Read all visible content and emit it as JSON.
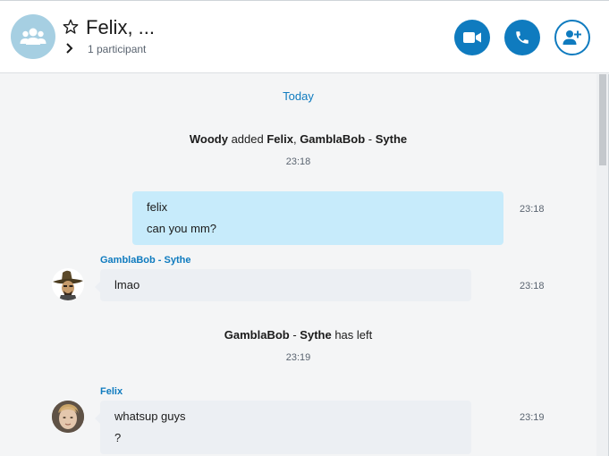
{
  "header": {
    "title": "Felix, ...",
    "participants": "1 participant",
    "icons": {
      "group": "group-icon",
      "favorite": "star-outline-icon",
      "expand": "chevron-right-icon",
      "video": "video-camera-icon",
      "call": "phone-icon",
      "add": "add-person-icon"
    },
    "accent_color": "#0f7bbf"
  },
  "chat": {
    "date_divider": "Today",
    "events": {
      "added": {
        "actor": "Woody",
        "verb": " added ",
        "target1": "Felix",
        "sep1": ", ",
        "target2a": "GamblaBob",
        "dash": " - ",
        "target2b": "Sythe",
        "time": "23:18"
      },
      "left": {
        "actor_a": "GamblaBob",
        "dash": " - ",
        "actor_b": "Sythe",
        "verb": " has left",
        "time": "23:19"
      }
    },
    "messages": {
      "own": {
        "lines": [
          "felix",
          "can you mm?"
        ],
        "time": "23:18"
      },
      "gambla": {
        "sender": "GamblaBob - Sythe",
        "lines": [
          "lmao"
        ],
        "time": "23:18"
      },
      "felix": {
        "sender": "Felix",
        "lines": [
          "whatsup guys",
          "?"
        ],
        "time": "23:19"
      }
    }
  }
}
